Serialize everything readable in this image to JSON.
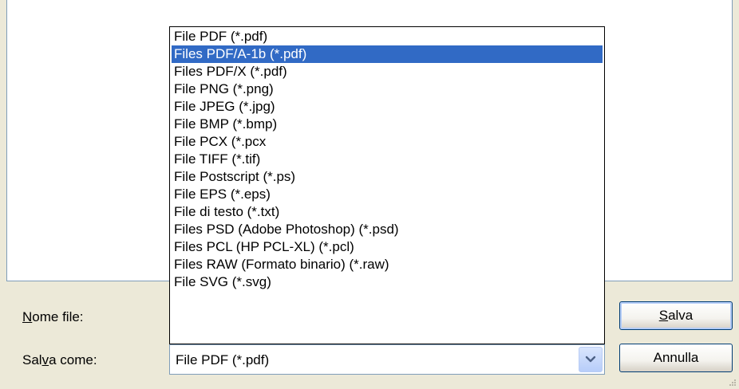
{
  "dialog": {
    "filename_label_prefix": "",
    "filename_label_mnemonic": "N",
    "filename_label_rest": "ome file:",
    "saveas_label_prefix": "Sal",
    "saveas_label_mnemonic": "v",
    "saveas_label_rest": "a come:",
    "save_button_mnemonic": "S",
    "save_button_rest": "alva",
    "cancel_button": "Annulla"
  },
  "combobox": {
    "selected_value": "File PDF (*.pdf)",
    "arrow_icon": "chevron-down-icon"
  },
  "dropdown": {
    "highlighted_index": 1,
    "items": [
      "File PDF (*.pdf)",
      "Files PDF/A-1b (*.pdf)",
      "Files PDF/X (*.pdf)",
      "File PNG (*.png)",
      "File JPEG (*.jpg)",
      "File BMP (*.bmp)",
      "File PCX (*.pcx",
      "File TIFF (*.tif)",
      "File Postscript (*.ps)",
      "File EPS (*.eps)",
      "File di testo (*.txt)",
      "Files PSD (Adobe Photoshop) (*.psd)",
      "Files PCL (HP PCL-XL) (*.pcl)",
      "Files RAW (Formato binario) (*.raw)",
      "File SVG (*.svg)"
    ]
  },
  "colors": {
    "highlight": "#316ac5",
    "dialog_background": "#ece9d8",
    "border": "#7f9db9"
  }
}
